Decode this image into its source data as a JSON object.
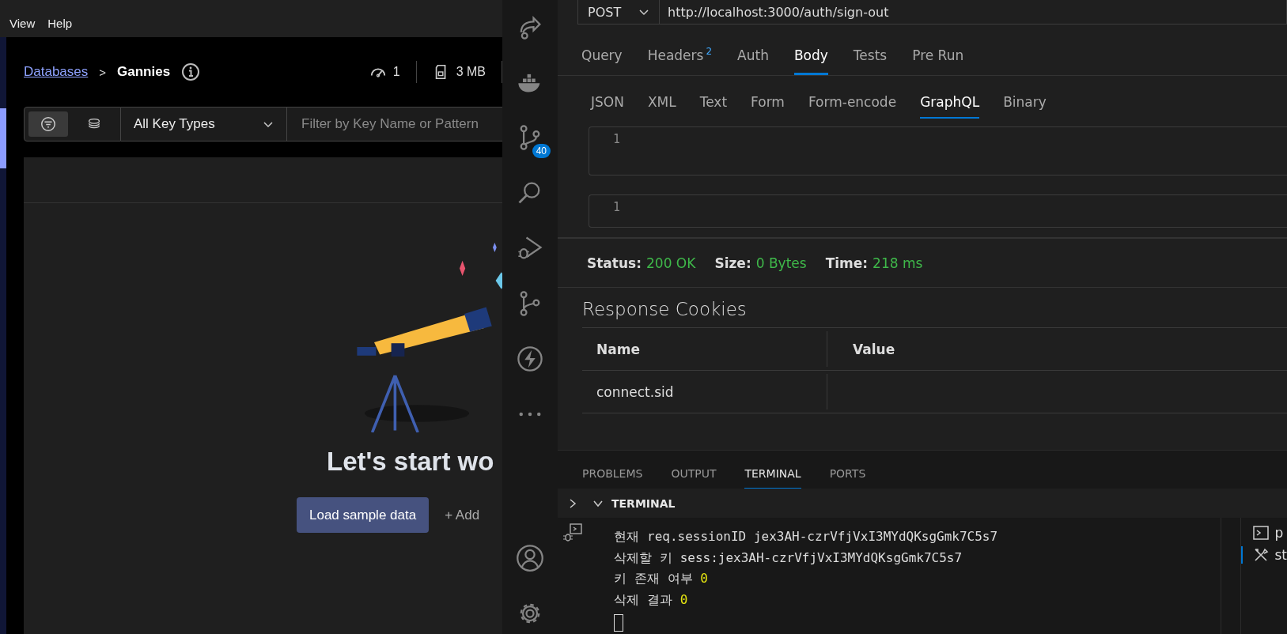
{
  "menu": [
    {
      "label": "View"
    },
    {
      "label": "Help"
    }
  ],
  "browser": {
    "breadcrumb": {
      "link": "Databases",
      "separator": ">",
      "current": "Gannies"
    },
    "stats": [
      {
        "kind": "commands",
        "value": "1"
      },
      {
        "kind": "memory",
        "value": "3 MB"
      }
    ],
    "filter": {
      "modes": [
        {
          "kind": "filter",
          "selected": true
        },
        {
          "kind": "search",
          "selected": false
        }
      ],
      "key_type": "All Key Types",
      "placeholder": "Filter by Key Name or Pattern"
    },
    "empty_state": {
      "heading": "Let's start wo",
      "primary_button": "Load sample data",
      "secondary_button": "+ Add"
    }
  },
  "activity_bar": [
    {
      "kind": "share"
    },
    {
      "kind": "docker"
    },
    {
      "kind": "branches",
      "badge": "40"
    },
    {
      "kind": "search"
    },
    {
      "kind": "run-debug"
    },
    {
      "kind": "source-control"
    },
    {
      "kind": "lightning"
    },
    {
      "kind": "more"
    },
    {
      "kind": "account"
    },
    {
      "kind": "settings"
    }
  ],
  "request": {
    "method": "POST",
    "url": "http://localhost:3000/auth/sign-out",
    "tabs": [
      {
        "label": "Query",
        "selected": false
      },
      {
        "label": "Headers",
        "count": "2",
        "selected": false
      },
      {
        "label": "Auth",
        "selected": false
      },
      {
        "label": "Body",
        "selected": true
      },
      {
        "label": "Tests",
        "selected": false
      },
      {
        "label": "Pre Run",
        "selected": false
      }
    ],
    "body_types": [
      {
        "label": "JSON",
        "selected": false
      },
      {
        "label": "XML",
        "selected": false
      },
      {
        "label": "Text",
        "selected": false
      },
      {
        "label": "Form",
        "selected": false
      },
      {
        "label": "Form-encode",
        "selected": false
      },
      {
        "label": "GraphQL",
        "selected": true
      },
      {
        "label": "Binary",
        "selected": false
      }
    ],
    "editors": [
      {
        "line": "1"
      },
      {
        "line": "1"
      }
    ]
  },
  "response": {
    "metrics": [
      {
        "label": "Status:",
        "value": "200 OK"
      },
      {
        "label": "Size:",
        "value": "0 Bytes"
      },
      {
        "label": "Time:",
        "value": "218 ms"
      }
    ],
    "cookies": {
      "title": "Response Cookies",
      "columns": [
        "Name",
        "Value"
      ],
      "rows": [
        {
          "name": "connect.sid"
        }
      ]
    }
  },
  "panel": {
    "tabs": [
      {
        "label": "PROBLEMS",
        "selected": false
      },
      {
        "label": "OUTPUT",
        "selected": false
      },
      {
        "label": "TERMINAL",
        "selected": true
      },
      {
        "label": "PORTS",
        "selected": false
      }
    ],
    "terminal_title": "TERMINAL",
    "lines": [
      {
        "text": "현재 req.sessionID jex3AH-czrVfjVxI3MYdQKsgGmk7C5s7"
      },
      {
        "text": "삭제할 키 sess:jex3AH-czrVfjVxI3MYdQKsgGmk7C5s7"
      },
      {
        "text": "키 존재 여부",
        "value": "0"
      },
      {
        "text": "삭제 결과",
        "value": "0"
      }
    ],
    "terminals": [
      {
        "kind": "shell",
        "label": "p"
      },
      {
        "kind": "tools",
        "label": "st"
      }
    ]
  }
}
